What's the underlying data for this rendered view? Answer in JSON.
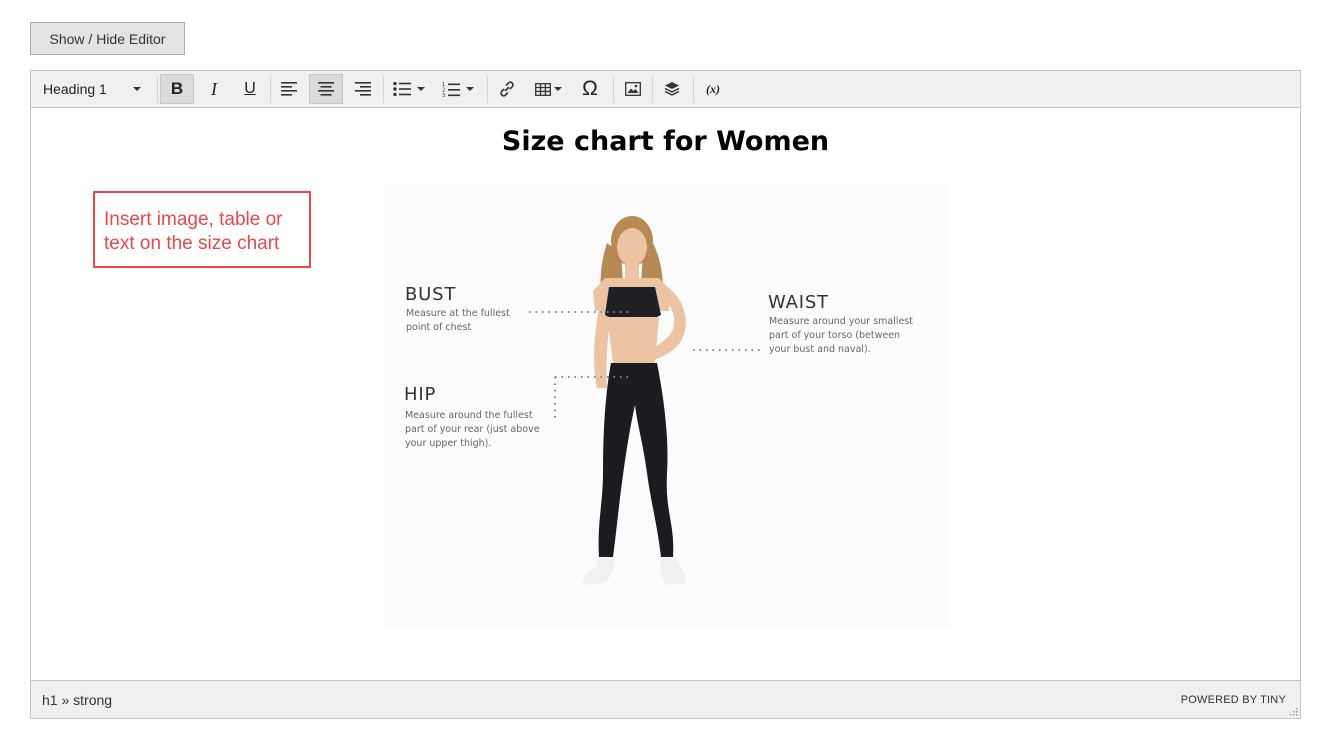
{
  "toggle_editor": {
    "label": "Show / Hide Editor"
  },
  "toolbar": {
    "format_select": "Heading 1",
    "buttons": [
      {
        "name": "bold",
        "label": "B"
      },
      {
        "name": "italic",
        "label": "I"
      },
      {
        "name": "underline",
        "label": "U"
      },
      {
        "name": "charmap",
        "label": "Ω"
      },
      {
        "name": "variables",
        "label": "(x)"
      }
    ],
    "active": [
      "bold",
      "align-center"
    ]
  },
  "content": {
    "title": "Size chart for Women",
    "image": {
      "bust": {
        "title": "BUST",
        "lines": [
          "Measure at the fullest",
          "point of chest"
        ]
      },
      "waist": {
        "title": "WAIST",
        "lines": [
          "Measure around your smallest",
          "part of your torso (between",
          "your bust and naval)."
        ]
      },
      "hip": {
        "title": "HIP",
        "lines": [
          "Measure around the fullest",
          "part of your rear (just above",
          "your upper thigh)."
        ]
      }
    }
  },
  "callout": {
    "text": "Insert image, table or text on the size chart",
    "color": "#e5484d"
  },
  "statusbar": {
    "path": "h1 » strong",
    "powered": "POWERED BY TINY"
  }
}
